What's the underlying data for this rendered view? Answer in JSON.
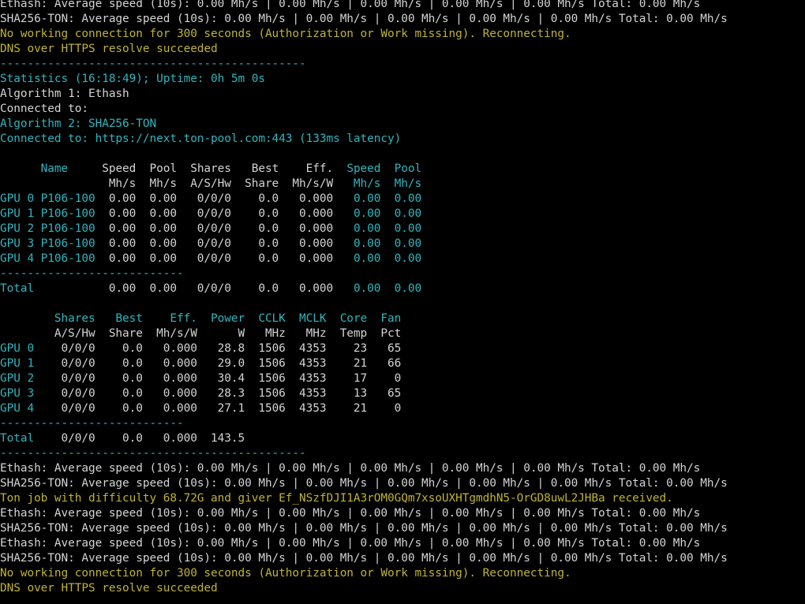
{
  "colors": {
    "background": "#000000",
    "white": "#d4d4d4",
    "yellow": "#c0b32f",
    "cyan": "#2eb6bf"
  },
  "lines": [
    {
      "color": "w",
      "text": "Ethash: Average speed (10s): 0.00 Mh/s | 0.00 Mh/s | 0.00 Mh/s | 0.00 Mh/s | 0.00 Mh/s Total: 0.00 Mh/s"
    },
    {
      "color": "w",
      "text": "SHA256-TON: Average speed (10s): 0.00 Mh/s | 0.00 Mh/s | 0.00 Mh/s | 0.00 Mh/s | 0.00 Mh/s Total: 0.00 Mh/s"
    },
    {
      "color": "y",
      "text": "No working connection for 300 seconds (Authorization or Work missing). Reconnecting."
    },
    {
      "color": "y",
      "text": "DNS over HTTPS resolve succeeded"
    },
    {
      "color": "c",
      "text": "---------------------------------------------"
    },
    {
      "color": "c",
      "text": "Statistics (16:18:49); Uptime: 0h 5m 0s"
    },
    {
      "color": "w",
      "text": "Algorithm 1: Ethash"
    },
    {
      "color": "w",
      "text": "Connected to:"
    },
    {
      "color": "c",
      "text": "Algorithm 2: SHA256-TON"
    },
    {
      "color": "c",
      "text": "Connected to: https://next.ton-pool.com:443 (133ms latency)"
    },
    {
      "color": "w",
      "text": ""
    },
    {
      "segments": [
        {
          "color": "c",
          "text": "      Name     "
        },
        {
          "color": "w",
          "text": "Speed  Pool  Shares   Best    Eff.  "
        },
        {
          "color": "c",
          "text": "Speed  Pool"
        }
      ]
    },
    {
      "segments": [
        {
          "color": "w",
          "text": "                Mh/s  Mh/s  A/S/Hw  Share  Mh/s/W  "
        },
        {
          "color": "c",
          "text": " Mh/s  Mh/s"
        }
      ]
    },
    {
      "segments": [
        {
          "color": "c",
          "text": "GPU 0 P106-100  "
        },
        {
          "color": "w",
          "text": "0.00  0.00   0/0/0    0.0   0.000  "
        },
        {
          "color": "c",
          "text": " 0.00  0.00"
        }
      ]
    },
    {
      "segments": [
        {
          "color": "c",
          "text": "GPU 1 P106-100  "
        },
        {
          "color": "w",
          "text": "0.00  0.00   0/0/0    0.0   0.000  "
        },
        {
          "color": "c",
          "text": " 0.00  0.00"
        }
      ]
    },
    {
      "segments": [
        {
          "color": "c",
          "text": "GPU 2 P106-100  "
        },
        {
          "color": "w",
          "text": "0.00  0.00   0/0/0    0.0   0.000  "
        },
        {
          "color": "c",
          "text": " 0.00  0.00"
        }
      ]
    },
    {
      "segments": [
        {
          "color": "c",
          "text": "GPU 3 P106-100  "
        },
        {
          "color": "w",
          "text": "0.00  0.00   0/0/0    0.0   0.000  "
        },
        {
          "color": "c",
          "text": " 0.00  0.00"
        }
      ]
    },
    {
      "segments": [
        {
          "color": "c",
          "text": "GPU 4 P106-100  "
        },
        {
          "color": "w",
          "text": "0.00  0.00   0/0/0    0.0   0.000  "
        },
        {
          "color": "c",
          "text": " 0.00  0.00"
        }
      ]
    },
    {
      "color": "c",
      "text": "---------------------------"
    },
    {
      "segments": [
        {
          "color": "c",
          "text": "Total           "
        },
        {
          "color": "w",
          "text": "0.00  0.00   0/0/0    0.0   0.000  "
        },
        {
          "color": "c",
          "text": " 0.00  0.00"
        }
      ]
    },
    {
      "color": "w",
      "text": ""
    },
    {
      "color": "c",
      "text": "        Shares   Best    Eff.  Power  CCLK  MCLK  Core  Fan"
    },
    {
      "color": "w",
      "text": "        A/S/Hw  Share  Mh/s/W      W   MHz   MHz  Temp  Pct"
    },
    {
      "segments": [
        {
          "color": "c",
          "text": "GPU 0   "
        },
        {
          "color": "w",
          "text": " 0/0/0    0.0   0.000   28.8  1506  4353    23   65"
        }
      ]
    },
    {
      "segments": [
        {
          "color": "c",
          "text": "GPU 1   "
        },
        {
          "color": "w",
          "text": " 0/0/0    0.0   0.000   29.0  1506  4353    21   66"
        }
      ]
    },
    {
      "segments": [
        {
          "color": "c",
          "text": "GPU 2   "
        },
        {
          "color": "w",
          "text": " 0/0/0    0.0   0.000   30.4  1506  4353    17    0"
        }
      ]
    },
    {
      "segments": [
        {
          "color": "c",
          "text": "GPU 3   "
        },
        {
          "color": "w",
          "text": " 0/0/0    0.0   0.000   28.3  1506  4353    13   65"
        }
      ]
    },
    {
      "segments": [
        {
          "color": "c",
          "text": "GPU 4   "
        },
        {
          "color": "w",
          "text": " 0/0/0    0.0   0.000   27.1  1506  4353    21    0"
        }
      ]
    },
    {
      "color": "c",
      "text": "---------------------------"
    },
    {
      "segments": [
        {
          "color": "c",
          "text": "Total   "
        },
        {
          "color": "w",
          "text": " 0/0/0    0.0   0.000  143.5"
        }
      ]
    },
    {
      "color": "c",
      "text": "---------------------------------------------"
    },
    {
      "color": "w",
      "text": "Ethash: Average speed (10s): 0.00 Mh/s | 0.00 Mh/s | 0.00 Mh/s | 0.00 Mh/s | 0.00 Mh/s Total: 0.00 Mh/s"
    },
    {
      "color": "w",
      "text": "SHA256-TON: Average speed (10s): 0.00 Mh/s | 0.00 Mh/s | 0.00 Mh/s | 0.00 Mh/s | 0.00 Mh/s Total: 0.00 Mh/s"
    },
    {
      "color": "y",
      "text": "Ton job with difficulty 68.72G and giver Ef_NSzfDJI1A3rOM0GQm7xsoUXHTgmdhN5-OrGD8uwL2JHBa received."
    },
    {
      "color": "w",
      "text": "Ethash: Average speed (10s): 0.00 Mh/s | 0.00 Mh/s | 0.00 Mh/s | 0.00 Mh/s | 0.00 Mh/s Total: 0.00 Mh/s"
    },
    {
      "color": "w",
      "text": "SHA256-TON: Average speed (10s): 0.00 Mh/s | 0.00 Mh/s | 0.00 Mh/s | 0.00 Mh/s | 0.00 Mh/s Total: 0.00 Mh/s"
    },
    {
      "color": "w",
      "text": "Ethash: Average speed (10s): 0.00 Mh/s | 0.00 Mh/s | 0.00 Mh/s | 0.00 Mh/s | 0.00 Mh/s Total: 0.00 Mh/s"
    },
    {
      "color": "w",
      "text": "SHA256-TON: Average speed (10s): 0.00 Mh/s | 0.00 Mh/s | 0.00 Mh/s | 0.00 Mh/s | 0.00 Mh/s Total: 0.00 Mh/s"
    },
    {
      "color": "y",
      "text": "No working connection for 300 seconds (Authorization or Work missing). Reconnecting."
    },
    {
      "color": "y",
      "text": "DNS over HTTPS resolve succeeded"
    }
  ]
}
